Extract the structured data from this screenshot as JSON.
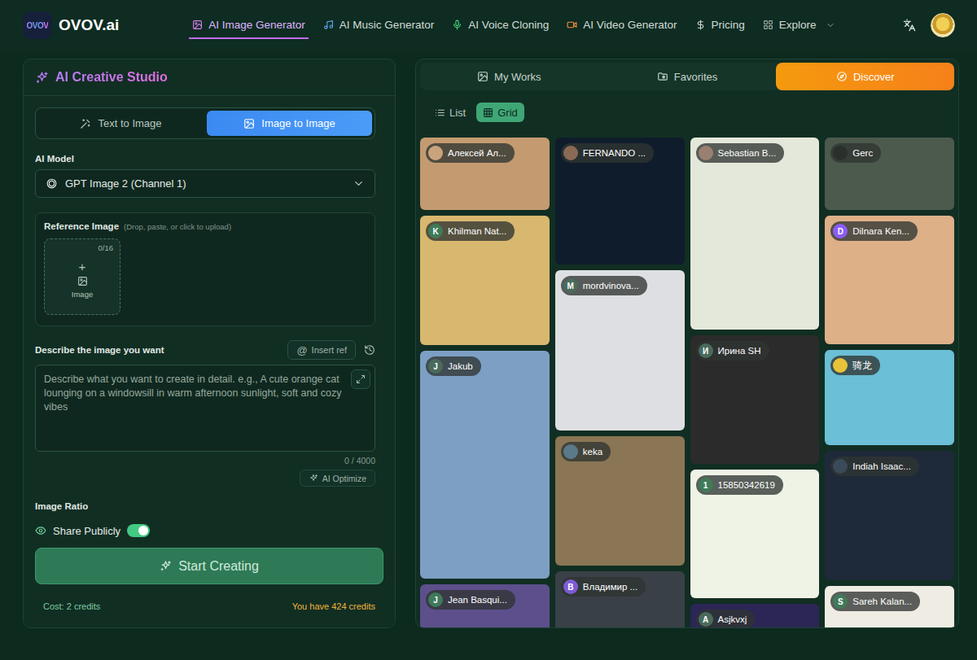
{
  "nav": {
    "logo_mark": "OVOV",
    "logo_text": "OVOV.ai",
    "items": [
      {
        "label": "AI Image Generator",
        "selected": true,
        "dropdown": false,
        "color": "#e07cf5"
      },
      {
        "label": "AI Music Generator",
        "selected": false,
        "dropdown": false,
        "color": "#5fa8f5"
      },
      {
        "label": "AI Voice Cloning",
        "selected": false,
        "dropdown": false,
        "color": "#4ade80"
      },
      {
        "label": "AI Video Generator",
        "selected": false,
        "dropdown": false,
        "color": "#fb923c"
      },
      {
        "label": "Pricing",
        "selected": false,
        "dropdown": false,
        "color": "#cdd7d2"
      },
      {
        "label": "Explore",
        "selected": false,
        "dropdown": true,
        "color": "#9fb0a8"
      }
    ]
  },
  "studio": {
    "title": "AI Creative Studio",
    "modes": [
      {
        "label": "Text to Image",
        "selected": false
      },
      {
        "label": "Image to Image",
        "selected": true
      }
    ],
    "model": {
      "label": "AI Model",
      "value": "GPT Image 2 (Channel 1)"
    },
    "reference": {
      "label": "Reference Image",
      "hint": "(Drop, paste, or click to upload)",
      "count": "0/16",
      "plus": "+",
      "upload_label": "Image"
    },
    "prompt": {
      "label": "Describe the image you want",
      "insert_ref_icon": "@",
      "insert_ref": "Insert ref",
      "placeholder": "Describe what you want to create in detail. e.g., A cute orange cat lounging on a windowsill in warm afternoon sunlight, soft and cozy vibes",
      "counter": "0 / 4000",
      "optimize": "AI Optimize"
    },
    "ratio_label": "Image Ratio",
    "share": {
      "label": "Share Publicly",
      "on": true
    },
    "create_button": "Start Creating",
    "cost": "Cost: 2 credits",
    "balance": "You have 424 credits"
  },
  "gallery": {
    "tabs": [
      {
        "label": "My Works",
        "selected": false
      },
      {
        "label": "Favorites",
        "selected": false
      },
      {
        "label": "Discover",
        "selected": true
      }
    ],
    "views": [
      {
        "label": "List",
        "selected": false
      },
      {
        "label": "Grid",
        "selected": true
      }
    ],
    "columns": [
      [
        {
          "user": "Алексей Ал...",
          "avatar": {
            "kind": "photo",
            "color": "#c9a37c"
          },
          "color": "#c49a70"
        },
        {
          "user": "Khilman Nat...",
          "avatar": {
            "kind": "letter",
            "text": "K",
            "color": "#3f7a5a"
          },
          "color": "#d8b86e"
        },
        {
          "user": "Jakub",
          "avatar": {
            "kind": "letter",
            "text": "J",
            "color": "#4a6b5c"
          },
          "color": "#7d9fc4"
        },
        {
          "user": "Jean Basqui...",
          "avatar": {
            "kind": "letter",
            "text": "J",
            "color": "#3f7a5a"
          },
          "color": "#5d4f8c"
        }
      ],
      [
        {
          "user": "FERNANDO ...",
          "avatar": {
            "kind": "photo",
            "color": "#8a6a55"
          },
          "color": "#0f1c2c"
        },
        {
          "user": "mordvinova...",
          "avatar": {
            "kind": "letter",
            "text": "M",
            "color": "#4a6b5c"
          },
          "color": "#dedfe2"
        },
        {
          "user": "keka",
          "avatar": {
            "kind": "photo",
            "color": "#5a7a8a"
          },
          "color": "#8a7655"
        },
        {
          "user": "Владимир ...",
          "avatar": {
            "kind": "letter",
            "text": "В",
            "color": "#7c5cd6"
          },
          "color": "#3a4047"
        }
      ],
      [
        {
          "user": "Sebastian B...",
          "avatar": {
            "kind": "photo",
            "color": "#9a8070"
          },
          "color": "#e4e8da"
        },
        {
          "user": "Ирина SH",
          "avatar": {
            "kind": "letter",
            "text": "И",
            "color": "#4a6b5c"
          },
          "color": "#2b2b2b"
        },
        {
          "user": "15850342619",
          "avatar": {
            "kind": "letter",
            "text": "1",
            "color": "#3f7a5a"
          },
          "color": "#eef3e6"
        },
        {
          "user": "Asjkvxj",
          "avatar": {
            "kind": "letter",
            "text": "A",
            "color": "#4a6b5c"
          },
          "color": "#2b2656"
        }
      ],
      [
        {
          "user": "Gerc",
          "avatar": {
            "kind": "photo",
            "color": "#2a2f2c"
          },
          "color": "#4b5a4c"
        },
        {
          "user": "Dilnara Ken...",
          "avatar": {
            "kind": "letter",
            "text": "D",
            "color": "#8b5cf6"
          },
          "color": "#ddb088"
        },
        {
          "user": "骑龙",
          "avatar": {
            "kind": "photo",
            "color": "#e8c23a"
          },
          "color": "#6bbfd6"
        },
        {
          "user": "Indiah Isaac...",
          "avatar": {
            "kind": "photo",
            "color": "#3a4a5a"
          },
          "color": "#1e2939"
        },
        {
          "user": "Sareh Kalan...",
          "avatar": {
            "kind": "letter",
            "text": "S",
            "color": "#3f7a5a"
          },
          "color": "#efece4"
        }
      ]
    ]
  }
}
